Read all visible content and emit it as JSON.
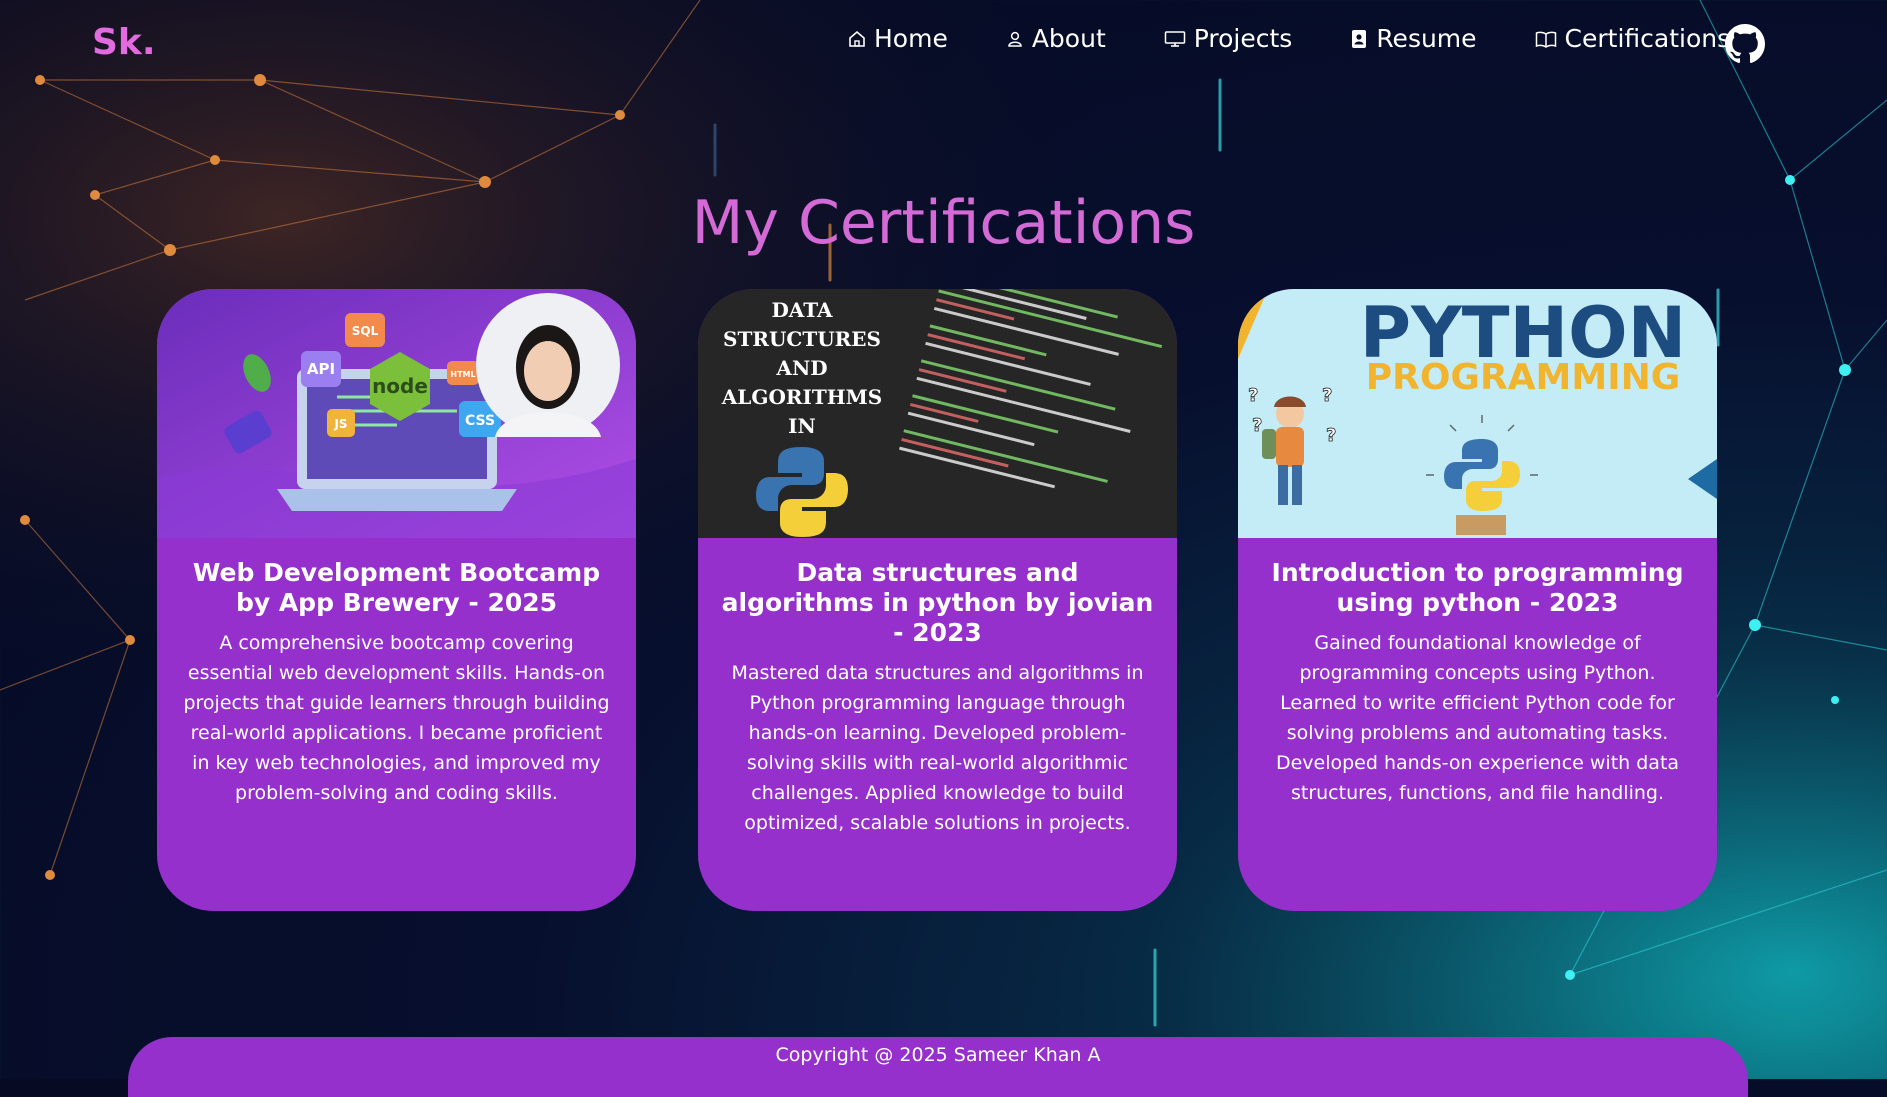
{
  "brand": {
    "logo": "Sk."
  },
  "nav": {
    "items": [
      {
        "label": "Home",
        "icon": "home-icon"
      },
      {
        "label": "About",
        "icon": "user-icon"
      },
      {
        "label": "Projects",
        "icon": "monitor-icon"
      },
      {
        "label": "Resume",
        "icon": "badge-icon"
      },
      {
        "label": "Certifications",
        "icon": "book-icon"
      }
    ],
    "github_icon": "github-icon"
  },
  "page": {
    "title": "My Certifications"
  },
  "cards": [
    {
      "title": "Web Development Bootcamp by App Brewery - 2025",
      "description": "A comprehensive bootcamp covering essential web development skills. Hands-on projects that guide learners through building real-world applications. I became proficient in key web technologies, and improved my problem-solving and coding skills.",
      "thumb": {
        "badges": [
          "SQL",
          "API",
          "HTML",
          "JS",
          "CSS"
        ],
        "logo": "node"
      }
    },
    {
      "title": "Data structures and algorithms in python by jovian - 2023",
      "description": "Mastered data structures and algorithms in Python programming language through hands-on learning. Developed problem-solving skills with real-world algorithmic challenges. Applied knowledge to build optimized, scalable solutions in projects.",
      "thumb": {
        "lines": [
          "DATA",
          "STRUCTURES",
          "AND",
          "ALGORITHMS",
          "IN"
        ]
      }
    },
    {
      "title": "Introduction to programming using python - 2023",
      "description": "Gained foundational knowledge of programming concepts using Python. Learned to write efficient Python code for solving problems and automating tasks. Developed hands-on experience with data structures, functions, and file handling.",
      "thumb": {
        "heading": "PYTHON",
        "subheading": "PROGRAMMING"
      }
    }
  ],
  "footer": {
    "text": "Copyright @ 2025 Sameer Khan A"
  },
  "colors": {
    "accent": "#9530cc",
    "title": "#d36ad6",
    "logo": "#e36be0"
  }
}
